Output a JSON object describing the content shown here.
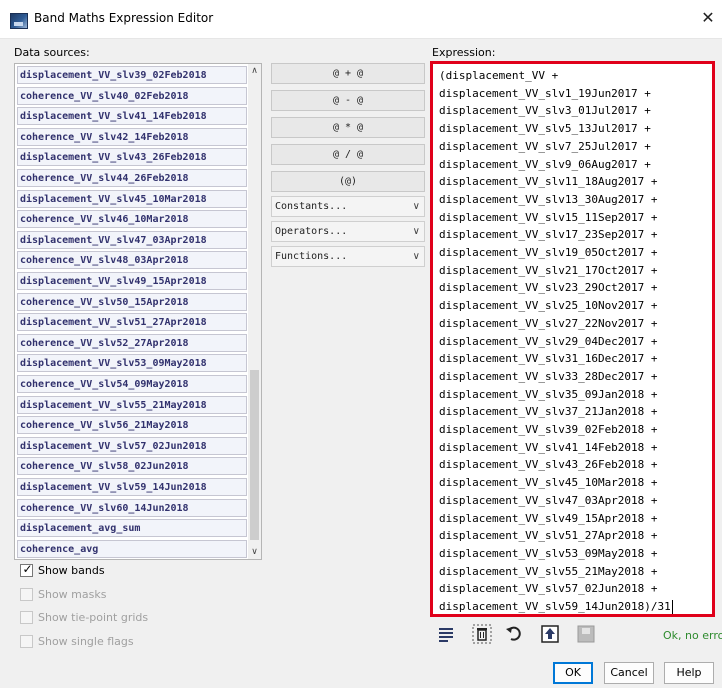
{
  "window": {
    "title": "Band Maths Expression Editor",
    "close": "✕"
  },
  "data_sources": {
    "label": "Data sources:",
    "items": [
      "displacement_VV_slv39_02Feb2018",
      "coherence_VV_slv40_02Feb2018",
      "displacement_VV_slv41_14Feb2018",
      "coherence_VV_slv42_14Feb2018",
      "displacement_VV_slv43_26Feb2018",
      "coherence_VV_slv44_26Feb2018",
      "displacement_VV_slv45_10Mar2018",
      "coherence_VV_slv46_10Mar2018",
      "displacement_VV_slv47_03Apr2018",
      "coherence_VV_slv48_03Apr2018",
      "displacement_VV_slv49_15Apr2018",
      "coherence_VV_slv50_15Apr2018",
      "displacement_VV_slv51_27Apr2018",
      "coherence_VV_slv52_27Apr2018",
      "displacement_VV_slv53_09May2018",
      "coherence_VV_slv54_09May2018",
      "displacement_VV_slv55_21May2018",
      "coherence_VV_slv56_21May2018",
      "displacement_VV_slv57_02Jun2018",
      "coherence_VV_slv58_02Jun2018",
      "displacement_VV_slv59_14Jun2018",
      "coherence_VV_slv60_14Jun2018",
      "displacement_avg_sum",
      "coherence_avg"
    ]
  },
  "operators": {
    "buttons": [
      "@ + @",
      "@ - @",
      "@ * @",
      "@ / @",
      "(@)"
    ],
    "combos": [
      "Constants...",
      "Operators...",
      "Functions..."
    ],
    "chevron": "∨"
  },
  "checkboxes": [
    {
      "label": "Show bands",
      "checked": true,
      "enabled": true
    },
    {
      "label": "Show masks",
      "checked": false,
      "enabled": false
    },
    {
      "label": "Show tie-point grids",
      "checked": false,
      "enabled": false
    },
    {
      "label": "Show single flags",
      "checked": false,
      "enabled": false
    }
  ],
  "expression": {
    "label": "Expression:",
    "lines": [
      "(displacement_VV +",
      "displacement_VV_slv1_19Jun2017 +",
      "displacement_VV_slv3_01Jul2017 +",
      "displacement_VV_slv5_13Jul2017 +",
      "displacement_VV_slv7_25Jul2017 +",
      "displacement_VV_slv9_06Aug2017 +",
      "displacement_VV_slv11_18Aug2017 +",
      "displacement_VV_slv13_30Aug2017 +",
      "displacement_VV_slv15_11Sep2017 +",
      "displacement_VV_slv17_23Sep2017 +",
      "displacement_VV_slv19_05Oct2017 +",
      "displacement_VV_slv21_17Oct2017 +",
      "displacement_VV_slv23_29Oct2017 +",
      "displacement_VV_slv25_10Nov2017 +",
      "displacement_VV_slv27_22Nov2017 +",
      "displacement_VV_slv29_04Dec2017 +",
      "displacement_VV_slv31_16Dec2017 +",
      "displacement_VV_slv33_28Dec2017 +",
      "displacement_VV_slv35_09Jan2018 +",
      "displacement_VV_slv37_21Jan2018 +",
      "displacement_VV_slv39_02Feb2018 +",
      "displacement_VV_slv41_14Feb2018 +",
      "displacement_VV_slv43_26Feb2018 +",
      "displacement_VV_slv45_10Mar2018 +",
      "displacement_VV_slv47_03Apr2018 +",
      "displacement_VV_slv49_15Apr2018 +",
      "displacement_VV_slv51_27Apr2018 +",
      "displacement_VV_slv53_09May2018 +",
      "displacement_VV_slv55_21May2018 +",
      "displacement_VV_slv57_02Jun2018 +",
      "displacement_VV_slv59_14Jun2018)/31"
    ],
    "highlight_color": "#e0001a"
  },
  "toolbar": {
    "icons": [
      "edit-expression-icon",
      "delete-icon",
      "redo-icon",
      "load-expression-icon",
      "save-expression-icon"
    ],
    "status": "Ok, no errors."
  },
  "buttons": {
    "ok": "OK",
    "cancel": "Cancel",
    "help": "Help"
  }
}
